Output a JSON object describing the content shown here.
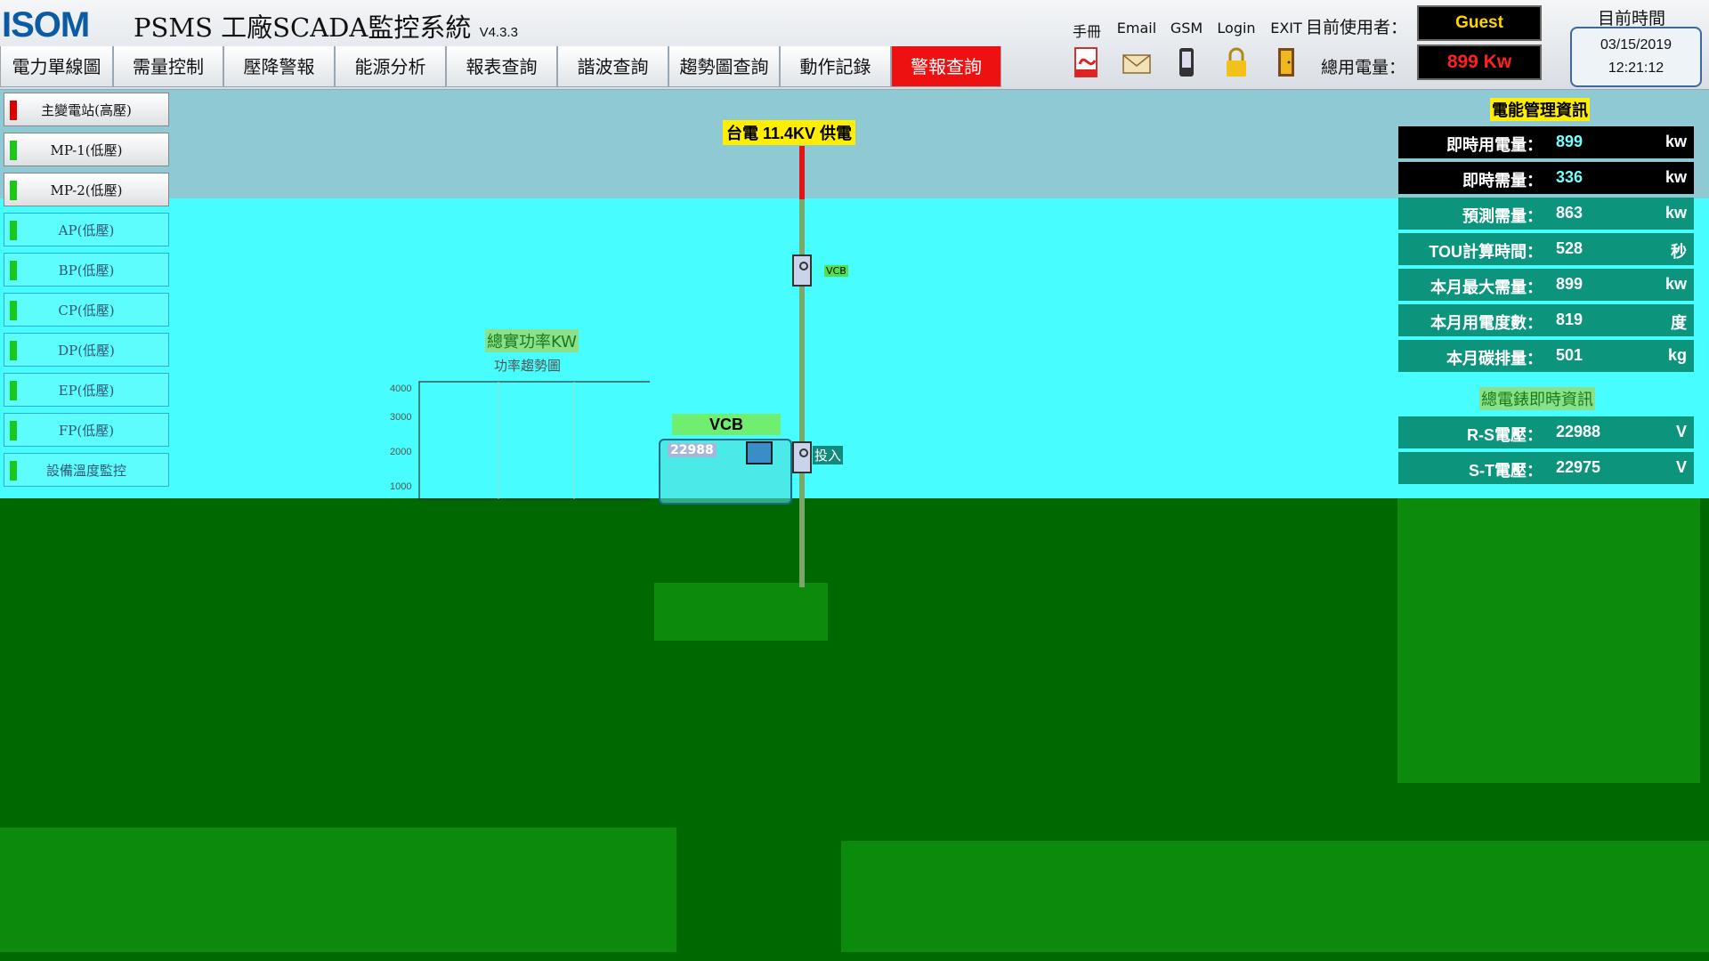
{
  "header": {
    "logo": "ISOM",
    "title": "PSMS 工廠SCADA監控系統",
    "version": "V4.3.3"
  },
  "nav": {
    "tabs": [
      "電力單線圖",
      "需量控制",
      "壓降警報",
      "能源分析",
      "報表查詢",
      "諧波查詢",
      "趨勢圖查詢",
      "動作記錄",
      "警報查詢"
    ]
  },
  "tools": [
    {
      "label": "手冊",
      "icon": "pdf-icon"
    },
    {
      "label": "Email",
      "icon": "email-icon"
    },
    {
      "label": "GSM",
      "icon": "phone-icon"
    },
    {
      "label": "Login",
      "icon": "lock-icon"
    },
    {
      "label": "EXIT",
      "icon": "exit-door-icon"
    }
  ],
  "user": {
    "label": "目前使用者：",
    "value": "Guest"
  },
  "total_power": {
    "label": "總用電量：",
    "value": "899 Kw"
  },
  "clock": {
    "title": "目前時間",
    "date": "03/15/2019",
    "time": "12:21:12"
  },
  "sidebar": {
    "items": [
      {
        "label": "主變電站(高壓)",
        "indicator": "red"
      },
      {
        "label": "MP-1(低壓)",
        "indicator": "green"
      },
      {
        "label": "MP-2(低壓)",
        "indicator": "green"
      },
      {
        "label": "AP(低壓)",
        "indicator": "green"
      },
      {
        "label": "BP(低壓)",
        "indicator": "green"
      },
      {
        "label": "CP(低壓)",
        "indicator": "green"
      },
      {
        "label": "DP(低壓)",
        "indicator": "green"
      },
      {
        "label": "EP(低壓)",
        "indicator": "green"
      },
      {
        "label": "FP(低壓)",
        "indicator": "green"
      },
      {
        "label": "設備溫度監控",
        "indicator": "green"
      }
    ]
  },
  "diagram": {
    "feed_label": "台電 11.4KV 供電",
    "vcb_small": "VCB",
    "vcb_label": "VCB",
    "vcb_value": "22988",
    "status": "投入"
  },
  "chart": {
    "title": "總實功率KW",
    "subtitle": "功率趨勢圖",
    "ticks": [
      "4000",
      "3000",
      "2000",
      "1000"
    ]
  },
  "info": {
    "title": "電能管理資訊",
    "rows": [
      {
        "label": "即時用電量：",
        "value": "899",
        "unit": "kw",
        "style": "black"
      },
      {
        "label": "即時需量：",
        "value": "336",
        "unit": "kw",
        "style": "black"
      },
      {
        "label": "預測需量：",
        "value": "863",
        "unit": "kw",
        "style": "teal"
      },
      {
        "label": "TOU計算時間：",
        "value": "528",
        "unit": "秒",
        "style": "teal"
      },
      {
        "label": "本月最大需量：",
        "value": "899",
        "unit": "kw",
        "style": "teal"
      },
      {
        "label": "本月用電度數：",
        "value": "819",
        "unit": "度",
        "style": "teal"
      },
      {
        "label": "本月碳排量：",
        "value": "501",
        "unit": "kg",
        "style": "teal"
      }
    ],
    "meter_title": "總電錶即時資訊",
    "meter_rows": [
      {
        "label": "R-S電壓：",
        "value": "22988",
        "unit": "V"
      },
      {
        "label": "S-T電壓：",
        "value": "22975",
        "unit": "V"
      }
    ]
  },
  "colors": {
    "cyan_band": "#48fdfd",
    "green_area": "#006800",
    "alarm_tab": "#ee1111",
    "user_text": "#ffd400",
    "power_text": "#ff2020"
  }
}
